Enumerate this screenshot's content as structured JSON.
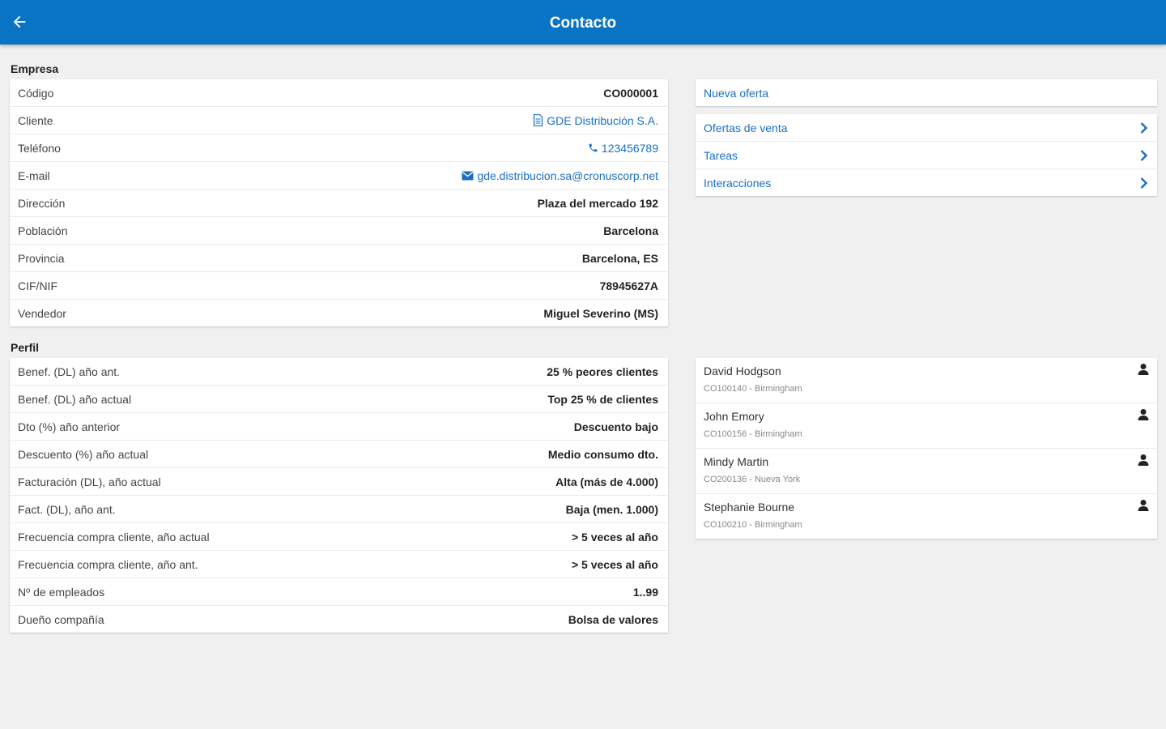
{
  "header": {
    "title": "Contacto",
    "back_icon": "arrow-left-icon",
    "bg_color": "#0a74c4"
  },
  "empresa": {
    "title": "Empresa",
    "rows": [
      {
        "label": "Código",
        "value": "CO000001"
      },
      {
        "label": "Cliente",
        "value": "GDE Distribución S.A.",
        "icon": "document-icon",
        "link": true
      },
      {
        "label": "Teléfono",
        "value": "123456789",
        "icon": "phone-icon",
        "link": true
      },
      {
        "label": "E-mail",
        "value": "gde.distribucion.sa@cronuscorp.net",
        "icon": "envelope-icon",
        "link": true
      },
      {
        "label": "Dirección",
        "value": "Plaza del mercado 192"
      },
      {
        "label": "Población",
        "value": "Barcelona"
      },
      {
        "label": "Provincia",
        "value": "Barcelona, ES"
      },
      {
        "label": "CIF/NIF",
        "value": "78945627A"
      },
      {
        "label": "Vendedor",
        "value": "Miguel Severino (MS)"
      }
    ]
  },
  "perfil": {
    "title": "Perfil",
    "rows": [
      {
        "label": "Benef. (DL) año ant.",
        "value": "25 % peores clientes"
      },
      {
        "label": "Benef. (DL) año actual",
        "value": "Top 25 % de clientes"
      },
      {
        "label": "Dto (%) año anterior",
        "value": "Descuento bajo"
      },
      {
        "label": "Descuento (%) año actual",
        "value": "Medio consumo dto."
      },
      {
        "label": "Facturación (DL), año actual",
        "value": "Alta (más de 4.000)"
      },
      {
        "label": "Fact. (DL), año ant.",
        "value": "Baja (men. 1.000)"
      },
      {
        "label": "Frecuencia compra cliente, año actual",
        "value": "> 5 veces al año"
      },
      {
        "label": "Frecuencia compra cliente, año ant.",
        "value": "> 5 veces al año"
      },
      {
        "label": "Nº de empleados",
        "value": "1..99"
      },
      {
        "label": "Dueño compañía",
        "value": "Bolsa de valores"
      }
    ]
  },
  "actions": {
    "new_offer": "Nueva oferta",
    "links": [
      "Ofertas de venta",
      "Tareas",
      "Interacciones"
    ]
  },
  "contacts": [
    {
      "name": "David Hodgson",
      "sub": "CO100140 - Birmingham"
    },
    {
      "name": "John Emory",
      "sub": "CO100156 - Birmingham"
    },
    {
      "name": "Mindy Martin",
      "sub": "CO200136 - Nueva York"
    },
    {
      "name": "Stephanie Bourne",
      "sub": "CO100210 - Birmingham"
    }
  ],
  "colors": {
    "link": "#1a6fc2",
    "background": "#f0f0f0"
  }
}
